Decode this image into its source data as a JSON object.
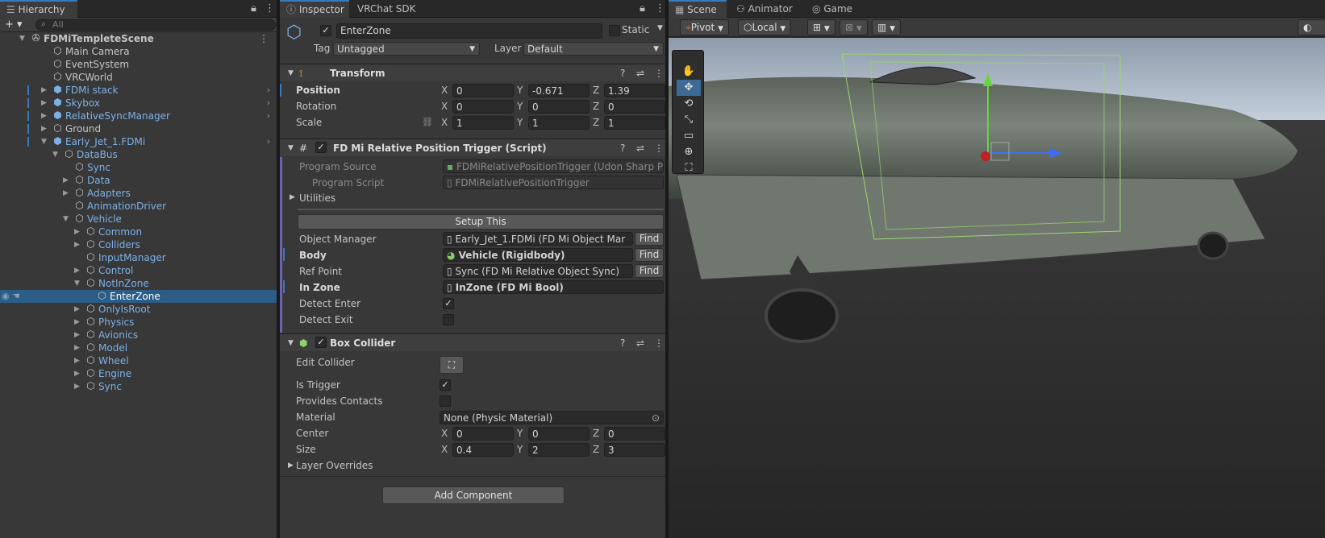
{
  "hierarchy": {
    "tab_label": "Hierarchy",
    "add_label": "+ ▾",
    "search_placeholder": "All",
    "rows": [
      {
        "label": "FDMiTempleteScene",
        "bold": true,
        "blue": false,
        "indent": 38,
        "fold": "▼",
        "icon": "scene-icon"
      },
      {
        "label": "Main Camera",
        "blue": false,
        "indent": 65,
        "fold": "",
        "icon": "cube-icon"
      },
      {
        "label": "EventSystem",
        "blue": false,
        "indent": 65,
        "fold": "",
        "icon": "cube-icon"
      },
      {
        "label": "VRCWorld",
        "blue": false,
        "indent": 65,
        "fold": "",
        "icon": "cube-icon"
      },
      {
        "label": "FDMi stack",
        "blue": true,
        "indent": 65,
        "fold": "▶",
        "icon": "prefab-icon",
        "bar": true,
        "arrow": true
      },
      {
        "label": "Skybox",
        "blue": true,
        "indent": 65,
        "fold": "▶",
        "icon": "prefab-icon",
        "bar": true,
        "arrow": true
      },
      {
        "label": "RelativeSyncManager",
        "blue": true,
        "indent": 65,
        "fold": "▶",
        "icon": "prefab-icon",
        "bar": true,
        "arrow": true
      },
      {
        "label": "Ground",
        "blue": false,
        "indent": 65,
        "fold": "▶",
        "icon": "cube-icon",
        "bar": true
      },
      {
        "label": "Early_Jet_1.FDMi",
        "blue": true,
        "indent": 65,
        "fold": "▼",
        "icon": "prefab-icon",
        "bar": true,
        "arrow": true
      },
      {
        "label": "DataBus",
        "blue": true,
        "indent": 79,
        "fold": "▼",
        "icon": "cube-icon"
      },
      {
        "label": "Sync",
        "blue": true,
        "indent": 92,
        "fold": "",
        "icon": "cube-icon"
      },
      {
        "label": "Data",
        "blue": true,
        "indent": 92,
        "fold": "▶",
        "icon": "cube-icon"
      },
      {
        "label": "Adapters",
        "blue": true,
        "indent": 92,
        "fold": "▶",
        "icon": "cube-icon"
      },
      {
        "label": "AnimationDriver",
        "blue": true,
        "indent": 92,
        "fold": "",
        "icon": "cube-icon"
      },
      {
        "label": "Vehicle",
        "blue": true,
        "indent": 92,
        "fold": "▼",
        "icon": "cube-icon"
      },
      {
        "label": "Common",
        "blue": true,
        "indent": 106,
        "fold": "▶",
        "icon": "cube-icon"
      },
      {
        "label": "Colliders",
        "blue": true,
        "indent": 106,
        "fold": "▶",
        "icon": "cube-icon"
      },
      {
        "label": "InputManager",
        "blue": true,
        "indent": 106,
        "fold": "",
        "icon": "cube-icon"
      },
      {
        "label": "Control",
        "blue": true,
        "indent": 106,
        "fold": "▶",
        "icon": "cube-icon"
      },
      {
        "label": "NotInZone",
        "blue": true,
        "indent": 106,
        "fold": "▼",
        "icon": "cube-icon"
      },
      {
        "label": "EnterZone",
        "blue": false,
        "indent": 120,
        "fold": "",
        "icon": "cube-icon",
        "selected": true
      },
      {
        "label": "OnlyIsRoot",
        "blue": true,
        "indent": 106,
        "fold": "▶",
        "icon": "cube-icon"
      },
      {
        "label": "Physics",
        "blue": true,
        "indent": 106,
        "fold": "▶",
        "icon": "cube-icon"
      },
      {
        "label": "Avionics",
        "blue": true,
        "indent": 106,
        "fold": "▶",
        "icon": "cube-icon"
      },
      {
        "label": "Model",
        "blue": true,
        "indent": 106,
        "fold": "▶",
        "icon": "cube-icon"
      },
      {
        "label": "Wheel",
        "blue": true,
        "indent": 106,
        "fold": "▶",
        "icon": "cube-icon"
      },
      {
        "label": "Engine",
        "blue": true,
        "indent": 106,
        "fold": "▶",
        "icon": "cube-icon"
      },
      {
        "label": "Sync",
        "blue": true,
        "indent": 106,
        "fold": "▶",
        "icon": "cube-icon"
      }
    ]
  },
  "inspector": {
    "tabs": [
      "Inspector",
      "VRChat SDK"
    ],
    "object_name": "EnterZone",
    "static_label": "Static",
    "tag_label": "Tag",
    "tag_value": "Untagged",
    "layer_label": "Layer",
    "layer_value": "Default",
    "transform": {
      "title": "Transform",
      "position_label": "Position",
      "rotation_label": "Rotation",
      "scale_label": "Scale",
      "position": [
        "0",
        "-0.671",
        "1.39"
      ],
      "rotation": [
        "0",
        "0",
        "0"
      ],
      "scale": [
        "1",
        "1",
        "1"
      ]
    },
    "axis": [
      "X",
      "Y",
      "Z"
    ],
    "script": {
      "title": "FD Mi Relative Position Trigger (Script)",
      "program_source_label": "Program Source",
      "program_source_value": "FDMiRelativePositionTrigger (Udon Sharp P",
      "program_script_label": "Program Script",
      "program_script_value": "FDMiRelativePositionTrigger",
      "utilities_label": "Utilities",
      "setup_label": "Setup This",
      "object_manager_label": "Object Manager",
      "object_manager_value": "Early_Jet_1.FDMi (FD Mi Object Mar",
      "body_label": "Body",
      "body_value": "Vehicle (Rigidbody)",
      "ref_point_label": "Ref Point",
      "ref_point_value": "Sync (FD Mi Relative Object Sync)",
      "in_zone_label": "In Zone",
      "in_zone_value": "InZone (FD Mi Bool)",
      "detect_enter_label": "Detect Enter",
      "detect_exit_label": "Detect Exit",
      "find_label": "Find"
    },
    "box_collider": {
      "title": "Box Collider",
      "edit_collider_label": "Edit Collider",
      "is_trigger_label": "Is Trigger",
      "provides_contacts_label": "Provides Contacts",
      "material_label": "Material",
      "material_value": "None (Physic Material)",
      "center_label": "Center",
      "size_label": "Size",
      "center": [
        "0",
        "0",
        "0"
      ],
      "size": [
        "0.4",
        "2",
        "3"
      ],
      "layer_overrides_label": "Layer Overrides"
    },
    "add_component_label": "Add Component"
  },
  "scene": {
    "tabs": [
      "Scene",
      "Animator",
      "Game"
    ],
    "pivot_label": "Pivot",
    "local_label": "Local"
  },
  "colors": {
    "selection": "#2c5d87",
    "prefab_blue": "#7cb1e8",
    "accent": "#3a79bb"
  }
}
